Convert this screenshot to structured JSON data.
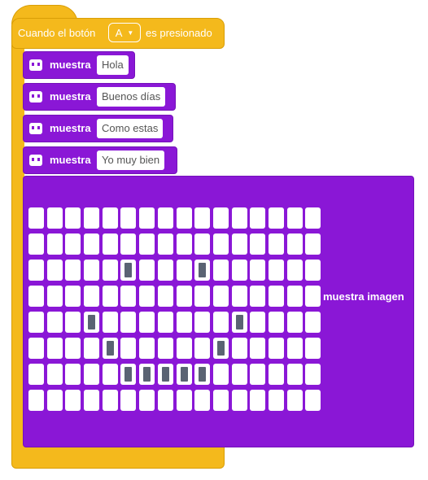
{
  "event_block": {
    "prefix": "Cuando el botón",
    "button_value": "A",
    "suffix": "es presionado",
    "color": "#f4b91c"
  },
  "show_blocks": [
    {
      "label": "muestra",
      "text": "Hola",
      "icon": "robot-icon"
    },
    {
      "label": "muestra",
      "text": "Buenos días",
      "icon": "robot-icon"
    },
    {
      "label": "muestra",
      "text": "Como estas",
      "icon": "robot-icon"
    },
    {
      "label": "muestra",
      "text": "Yo muy bien",
      "icon": "robot-icon"
    }
  ],
  "image_block": {
    "label": "muestra imagen",
    "color": "#8a17d6",
    "rows": 8,
    "cols": 16,
    "lit": [
      [
        2,
        5
      ],
      [
        2,
        9
      ],
      [
        4,
        3
      ],
      [
        4,
        11
      ],
      [
        5,
        4
      ],
      [
        5,
        10
      ],
      [
        6,
        5
      ],
      [
        6,
        6
      ],
      [
        6,
        7
      ],
      [
        6,
        8
      ],
      [
        6,
        9
      ]
    ]
  }
}
